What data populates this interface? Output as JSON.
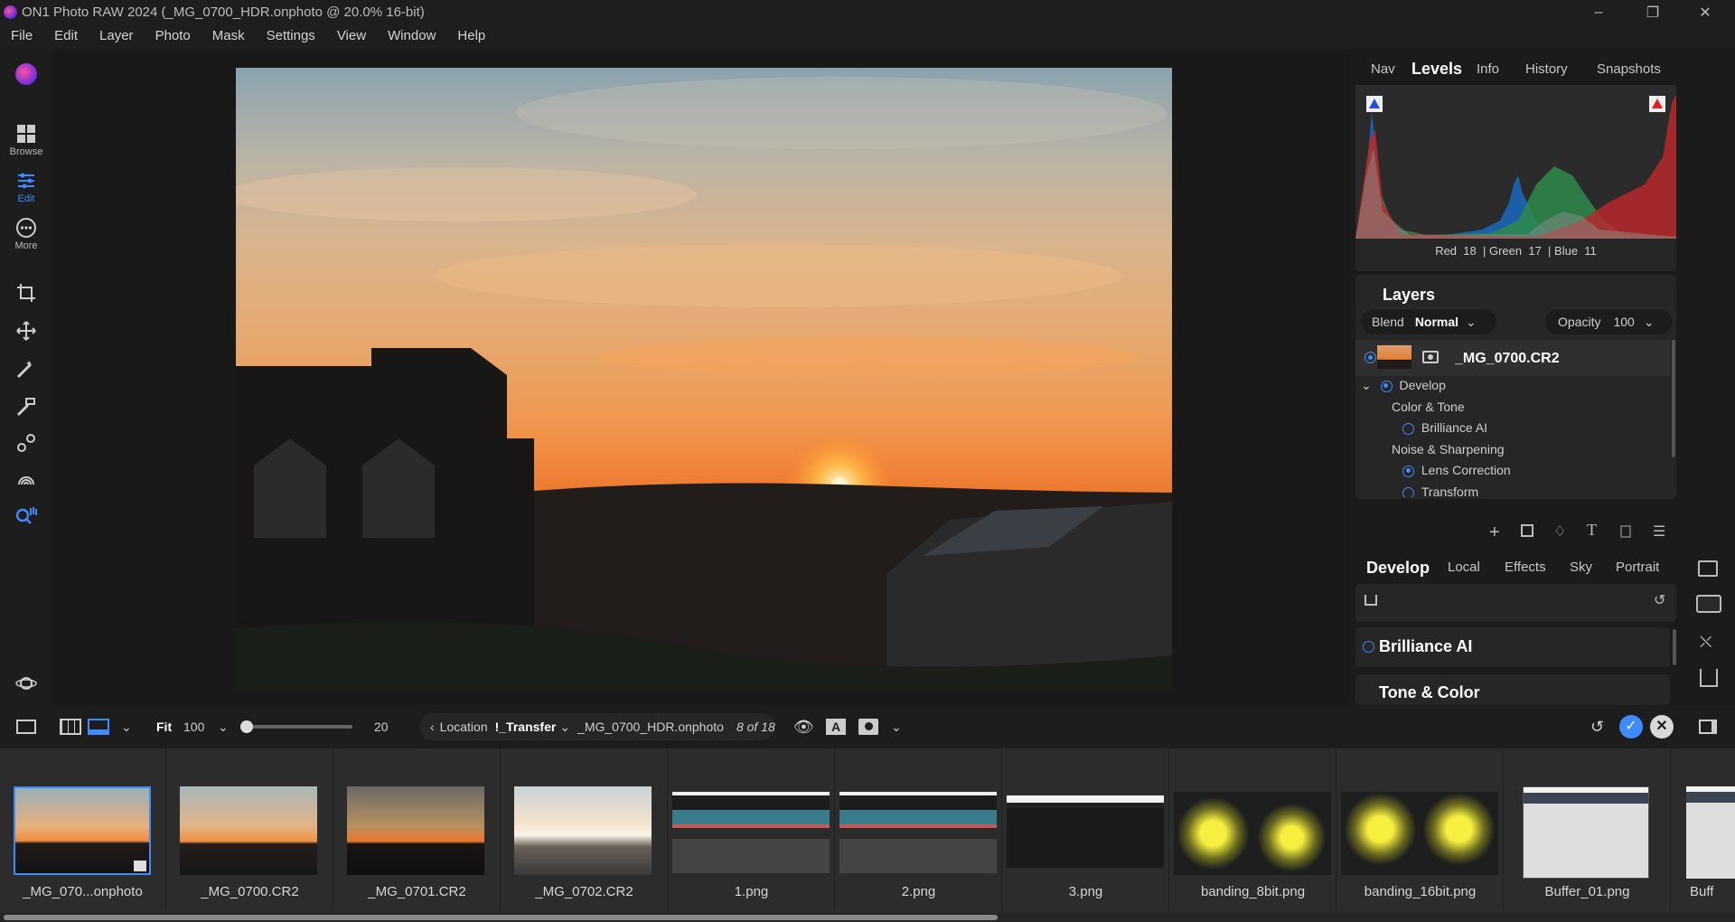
{
  "window": {
    "title": "ON1 Photo RAW 2024 (_MG_0700_HDR.onphoto @ 20.0% 16-bit)",
    "controls": [
      "minimize-icon",
      "restore-icon",
      "close-icon"
    ]
  },
  "menu": [
    "File",
    "Edit",
    "Layer",
    "Photo",
    "Mask",
    "Settings",
    "View",
    "Window",
    "Help"
  ],
  "left_toolbar": {
    "modes": [
      {
        "label": "Browse",
        "icon": "grid-icon"
      },
      {
        "label": "Edit",
        "icon": "sliders-icon",
        "active": true
      },
      {
        "label": "More",
        "icon": "more-icon"
      }
    ],
    "tools": [
      "crop-icon",
      "move-icon",
      "brush-icon",
      "mask-brush-icon",
      "clone-icon",
      "portrait-icon",
      "zoom-icon"
    ]
  },
  "right_panel": {
    "top_tabs": [
      {
        "label": "Nav"
      },
      {
        "label": "Levels",
        "active": true
      },
      {
        "label": "Info"
      },
      {
        "label": "History"
      },
      {
        "label": "Snapshots"
      }
    ],
    "levels_readout": {
      "red_label": "Red",
      "red": "18",
      "green_label": "| Green",
      "green": "17",
      "blue_label": "| Blue",
      "blue": "11"
    },
    "layers": {
      "title": "Layers",
      "blend_label": "Blend",
      "blend_value": "Normal",
      "opacity_label": "Opacity",
      "opacity_value": "100",
      "layer_name": "_MG_0700.CR2",
      "items": [
        {
          "label": "Develop",
          "level": 0
        },
        {
          "label": "Color & Tone",
          "level": 1
        },
        {
          "label": "Brilliance AI",
          "level": 2
        },
        {
          "label": "Noise & Sharpening",
          "level": 1
        },
        {
          "label": "Lens Correction",
          "level": 2
        },
        {
          "label": "Transform",
          "level": 2
        }
      ]
    },
    "module_tabs": [
      {
        "label": "Develop",
        "active": true
      },
      {
        "label": "Local"
      },
      {
        "label": "Effects"
      },
      {
        "label": "Sky"
      },
      {
        "label": "Portrait"
      }
    ],
    "sections": [
      "Brilliance AI",
      "Tone & Color"
    ]
  },
  "bottom_bar": {
    "fit_label": "Fit",
    "zoom_value": "100",
    "slider_value": "20",
    "slider_fraction": 0.0,
    "location_label": "Location",
    "folder": "!_Transfer",
    "filename": "_MG_0700_HDR.onphoto",
    "count": "8 of 18"
  },
  "filmstrip": [
    {
      "caption": "_MG_070...onphoto",
      "selected": true
    },
    {
      "caption": "_MG_0700.CR2"
    },
    {
      "caption": "_MG_0701.CR2"
    },
    {
      "caption": "_MG_0702.CR2"
    },
    {
      "caption": "1.png"
    },
    {
      "caption": "2.png"
    },
    {
      "caption": "3.png"
    },
    {
      "caption": "banding_8bit.png"
    },
    {
      "caption": "banding_16bit.png"
    },
    {
      "caption": "Buffer_01.png"
    },
    {
      "caption": "Buff"
    }
  ],
  "colors": {
    "accent": "#3d8bff",
    "panel": "#262626",
    "background": "#1b1b1b"
  }
}
